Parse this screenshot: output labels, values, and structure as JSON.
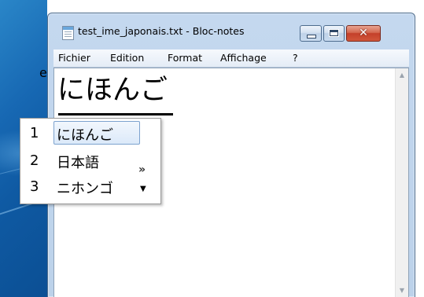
{
  "window": {
    "title": "test_ime_japonais.txt - Bloc-notes",
    "close_glyph": "✕"
  },
  "menu": {
    "items": [
      "Fichier",
      "Edition",
      "Format",
      "Affichage",
      "?"
    ]
  },
  "editor": {
    "text": "にほんご"
  },
  "ime": {
    "candidates": [
      {
        "number": "1",
        "text": "にほんご",
        "selected": true
      },
      {
        "number": "2",
        "text": "日本語",
        "selected": false
      },
      {
        "number": "3",
        "text": "ニホンゴ",
        "selected": false
      }
    ],
    "more_glyph": "»",
    "down_glyph": "▼"
  },
  "scrollbar": {
    "up_glyph": "▲",
    "down_glyph": "▼"
  },
  "desktop": {
    "edge_glyph": "e"
  }
}
